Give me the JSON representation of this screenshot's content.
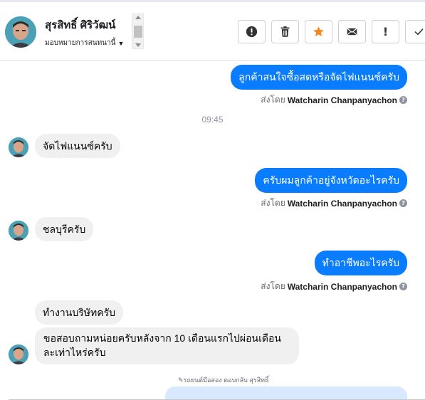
{
  "contact": {
    "name": "สุรสิทธิ์ ศิริวัฒน์",
    "assign_label": "มอบหมายการสนทนานี้"
  },
  "colors": {
    "outgoing_bubble": "#0a7cff",
    "incoming_bubble": "#f0f0f0",
    "star": "#f5871f"
  },
  "actions": [
    {
      "icon": "alert-circle-icon"
    },
    {
      "icon": "trash-icon"
    },
    {
      "icon": "star-icon"
    },
    {
      "icon": "envelope-icon"
    },
    {
      "icon": "exclamation-icon",
      "text": "!"
    },
    {
      "icon": "checkmark-icon"
    }
  ],
  "messages": {
    "m1": "ลูกค้าสนใจซื้อสดหรือจัดไฟแนนซ์ครับ",
    "time": "09:45",
    "m2": "จัดไฟแนนซ์ครับ",
    "m3": "ครับผมลูกค้าอยู่จังหวัดอะไรครับ",
    "m4": "ชลบุรีครับ",
    "m5": "ทำอาชีพอะไรครับ",
    "m6": "ทำงานบริษัทครับ",
    "m7": "ขอสอบถามหน่อยครับหลังจาก 10 เดือนแรกไปผ่อนเดือนละเท่าไหร่ครับ"
  },
  "sent_by": {
    "prefix": "ส่งโดย",
    "agent": "Watcharin Chanpanyachon",
    "help": "?"
  },
  "typing_note": "✎รถยนต์มือสอง ตอบกลับ สุรสิทธิ์"
}
